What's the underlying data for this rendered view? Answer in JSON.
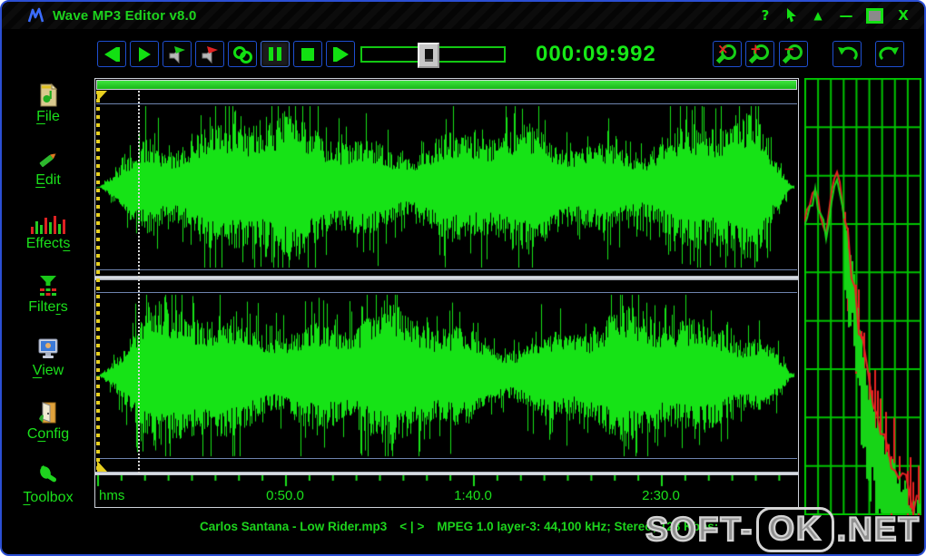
{
  "window": {
    "title": "Wave MP3 Editor v8.0"
  },
  "titlebar": {
    "help_glyph": "?",
    "up_glyph": "▲",
    "minimize_glyph": "—",
    "close_glyph": "X"
  },
  "toolbar": {
    "time_display": "000:09:992",
    "buttons": [
      "skip-to-start",
      "play",
      "play-device",
      "record",
      "loop",
      "pause",
      "stop",
      "skip-to-end"
    ],
    "zoom_buttons": [
      "zoom-selection",
      "zoom-in",
      "zoom-out"
    ],
    "history_buttons": [
      "undo",
      "redo"
    ],
    "zoom_overlays": {
      "cancel": "×",
      "plus": "+",
      "minus": "−"
    }
  },
  "sidebar": {
    "items": [
      {
        "name": "file",
        "pre": "",
        "accel": "F",
        "post": "ile"
      },
      {
        "name": "edit",
        "pre": "",
        "accel": "E",
        "post": "dit"
      },
      {
        "name": "effects",
        "pre": "Effect",
        "accel": "s",
        "post": ""
      },
      {
        "name": "filters",
        "pre": "Filte",
        "accel": "r",
        "post": "s"
      },
      {
        "name": "view",
        "pre": "",
        "accel": "V",
        "post": "iew"
      },
      {
        "name": "config",
        "pre": "C",
        "accel": "o",
        "post": "nfig"
      },
      {
        "name": "toolbox",
        "pre": "",
        "accel": "T",
        "post": "oolbox"
      }
    ]
  },
  "timeline": {
    "unit_label": "hms",
    "tick_labels": [
      "0:50.0",
      "1:40.0",
      "2:30.0"
    ]
  },
  "statusbar": {
    "track_title": "Carlos Santana - Low Rider.mp3",
    "nav_glyphs": "< | >",
    "format_info": "MPEG 1.0 layer-3: 44,100 kHz; Stereo; 128 Kbps;"
  },
  "watermark": {
    "left": "SOFT-",
    "boxed": "OK",
    "right": ".NET"
  },
  "colors": {
    "green_text": "#1be01b",
    "wave_green": "#16e316",
    "grid_green": "#00c400",
    "trace_red": "#e82222",
    "blue_border": "#2b4fd4",
    "yellow": "#e8d020"
  }
}
